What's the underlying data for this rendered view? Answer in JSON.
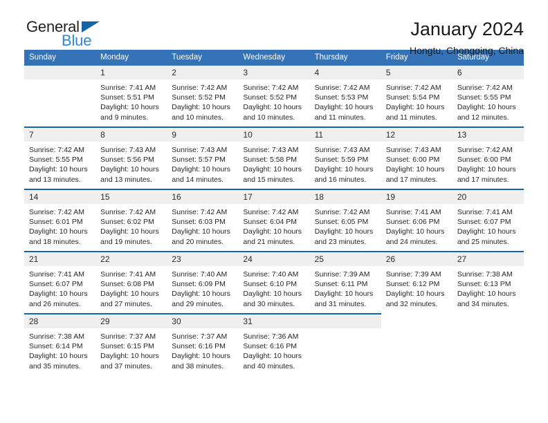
{
  "brand": {
    "name_part1": "General",
    "name_part2": "Blue",
    "accent_color": "#2e86d6",
    "triangle_color": "#1464a5"
  },
  "header": {
    "title": "January 2024",
    "subtitle": "Hongtu, Chongqing, China"
  },
  "calendar": {
    "header_bg": "#3573b9",
    "daynum_bg": "#efefef",
    "row_rule_color": "#1464a5",
    "weekday_headers": [
      "Sunday",
      "Monday",
      "Tuesday",
      "Wednesday",
      "Thursday",
      "Friday",
      "Saturday"
    ],
    "weeks": [
      [
        {
          "day": "",
          "sunrise": "",
          "sunset": "",
          "daylight1": "",
          "daylight2": "",
          "empty": true
        },
        {
          "day": "1",
          "sunrise": "Sunrise: 7:41 AM",
          "sunset": "Sunset: 5:51 PM",
          "daylight1": "Daylight: 10 hours",
          "daylight2": "and 9 minutes."
        },
        {
          "day": "2",
          "sunrise": "Sunrise: 7:42 AM",
          "sunset": "Sunset: 5:52 PM",
          "daylight1": "Daylight: 10 hours",
          "daylight2": "and 10 minutes."
        },
        {
          "day": "3",
          "sunrise": "Sunrise: 7:42 AM",
          "sunset": "Sunset: 5:52 PM",
          "daylight1": "Daylight: 10 hours",
          "daylight2": "and 10 minutes."
        },
        {
          "day": "4",
          "sunrise": "Sunrise: 7:42 AM",
          "sunset": "Sunset: 5:53 PM",
          "daylight1": "Daylight: 10 hours",
          "daylight2": "and 11 minutes."
        },
        {
          "day": "5",
          "sunrise": "Sunrise: 7:42 AM",
          "sunset": "Sunset: 5:54 PM",
          "daylight1": "Daylight: 10 hours",
          "daylight2": "and 11 minutes."
        },
        {
          "day": "6",
          "sunrise": "Sunrise: 7:42 AM",
          "sunset": "Sunset: 5:55 PM",
          "daylight1": "Daylight: 10 hours",
          "daylight2": "and 12 minutes."
        }
      ],
      [
        {
          "day": "7",
          "sunrise": "Sunrise: 7:42 AM",
          "sunset": "Sunset: 5:55 PM",
          "daylight1": "Daylight: 10 hours",
          "daylight2": "and 13 minutes."
        },
        {
          "day": "8",
          "sunrise": "Sunrise: 7:43 AM",
          "sunset": "Sunset: 5:56 PM",
          "daylight1": "Daylight: 10 hours",
          "daylight2": "and 13 minutes."
        },
        {
          "day": "9",
          "sunrise": "Sunrise: 7:43 AM",
          "sunset": "Sunset: 5:57 PM",
          "daylight1": "Daylight: 10 hours",
          "daylight2": "and 14 minutes."
        },
        {
          "day": "10",
          "sunrise": "Sunrise: 7:43 AM",
          "sunset": "Sunset: 5:58 PM",
          "daylight1": "Daylight: 10 hours",
          "daylight2": "and 15 minutes."
        },
        {
          "day": "11",
          "sunrise": "Sunrise: 7:43 AM",
          "sunset": "Sunset: 5:59 PM",
          "daylight1": "Daylight: 10 hours",
          "daylight2": "and 16 minutes."
        },
        {
          "day": "12",
          "sunrise": "Sunrise: 7:43 AM",
          "sunset": "Sunset: 6:00 PM",
          "daylight1": "Daylight: 10 hours",
          "daylight2": "and 17 minutes."
        },
        {
          "day": "13",
          "sunrise": "Sunrise: 7:42 AM",
          "sunset": "Sunset: 6:00 PM",
          "daylight1": "Daylight: 10 hours",
          "daylight2": "and 17 minutes."
        }
      ],
      [
        {
          "day": "14",
          "sunrise": "Sunrise: 7:42 AM",
          "sunset": "Sunset: 6:01 PM",
          "daylight1": "Daylight: 10 hours",
          "daylight2": "and 18 minutes."
        },
        {
          "day": "15",
          "sunrise": "Sunrise: 7:42 AM",
          "sunset": "Sunset: 6:02 PM",
          "daylight1": "Daylight: 10 hours",
          "daylight2": "and 19 minutes."
        },
        {
          "day": "16",
          "sunrise": "Sunrise: 7:42 AM",
          "sunset": "Sunset: 6:03 PM",
          "daylight1": "Daylight: 10 hours",
          "daylight2": "and 20 minutes."
        },
        {
          "day": "17",
          "sunrise": "Sunrise: 7:42 AM",
          "sunset": "Sunset: 6:04 PM",
          "daylight1": "Daylight: 10 hours",
          "daylight2": "and 21 minutes."
        },
        {
          "day": "18",
          "sunrise": "Sunrise: 7:42 AM",
          "sunset": "Sunset: 6:05 PM",
          "daylight1": "Daylight: 10 hours",
          "daylight2": "and 23 minutes."
        },
        {
          "day": "19",
          "sunrise": "Sunrise: 7:41 AM",
          "sunset": "Sunset: 6:06 PM",
          "daylight1": "Daylight: 10 hours",
          "daylight2": "and 24 minutes."
        },
        {
          "day": "20",
          "sunrise": "Sunrise: 7:41 AM",
          "sunset": "Sunset: 6:07 PM",
          "daylight1": "Daylight: 10 hours",
          "daylight2": "and 25 minutes."
        }
      ],
      [
        {
          "day": "21",
          "sunrise": "Sunrise: 7:41 AM",
          "sunset": "Sunset: 6:07 PM",
          "daylight1": "Daylight: 10 hours",
          "daylight2": "and 26 minutes."
        },
        {
          "day": "22",
          "sunrise": "Sunrise: 7:41 AM",
          "sunset": "Sunset: 6:08 PM",
          "daylight1": "Daylight: 10 hours",
          "daylight2": "and 27 minutes."
        },
        {
          "day": "23",
          "sunrise": "Sunrise: 7:40 AM",
          "sunset": "Sunset: 6:09 PM",
          "daylight1": "Daylight: 10 hours",
          "daylight2": "and 29 minutes."
        },
        {
          "day": "24",
          "sunrise": "Sunrise: 7:40 AM",
          "sunset": "Sunset: 6:10 PM",
          "daylight1": "Daylight: 10 hours",
          "daylight2": "and 30 minutes."
        },
        {
          "day": "25",
          "sunrise": "Sunrise: 7:39 AM",
          "sunset": "Sunset: 6:11 PM",
          "daylight1": "Daylight: 10 hours",
          "daylight2": "and 31 minutes."
        },
        {
          "day": "26",
          "sunrise": "Sunrise: 7:39 AM",
          "sunset": "Sunset: 6:12 PM",
          "daylight1": "Daylight: 10 hours",
          "daylight2": "and 32 minutes."
        },
        {
          "day": "27",
          "sunrise": "Sunrise: 7:38 AM",
          "sunset": "Sunset: 6:13 PM",
          "daylight1": "Daylight: 10 hours",
          "daylight2": "and 34 minutes."
        }
      ],
      [
        {
          "day": "28",
          "sunrise": "Sunrise: 7:38 AM",
          "sunset": "Sunset: 6:14 PM",
          "daylight1": "Daylight: 10 hours",
          "daylight2": "and 35 minutes."
        },
        {
          "day": "29",
          "sunrise": "Sunrise: 7:37 AM",
          "sunset": "Sunset: 6:15 PM",
          "daylight1": "Daylight: 10 hours",
          "daylight2": "and 37 minutes."
        },
        {
          "day": "30",
          "sunrise": "Sunrise: 7:37 AM",
          "sunset": "Sunset: 6:16 PM",
          "daylight1": "Daylight: 10 hours",
          "daylight2": "and 38 minutes."
        },
        {
          "day": "31",
          "sunrise": "Sunrise: 7:36 AM",
          "sunset": "Sunset: 6:16 PM",
          "daylight1": "Daylight: 10 hours",
          "daylight2": "and 40 minutes."
        },
        {
          "day": "",
          "sunrise": "",
          "sunset": "",
          "daylight1": "",
          "daylight2": "",
          "empty": true
        },
        {
          "day": "",
          "sunrise": "",
          "sunset": "",
          "daylight1": "",
          "daylight2": "",
          "void": true
        },
        {
          "day": "",
          "sunrise": "",
          "sunset": "",
          "daylight1": "",
          "daylight2": "",
          "void": true
        }
      ]
    ]
  }
}
